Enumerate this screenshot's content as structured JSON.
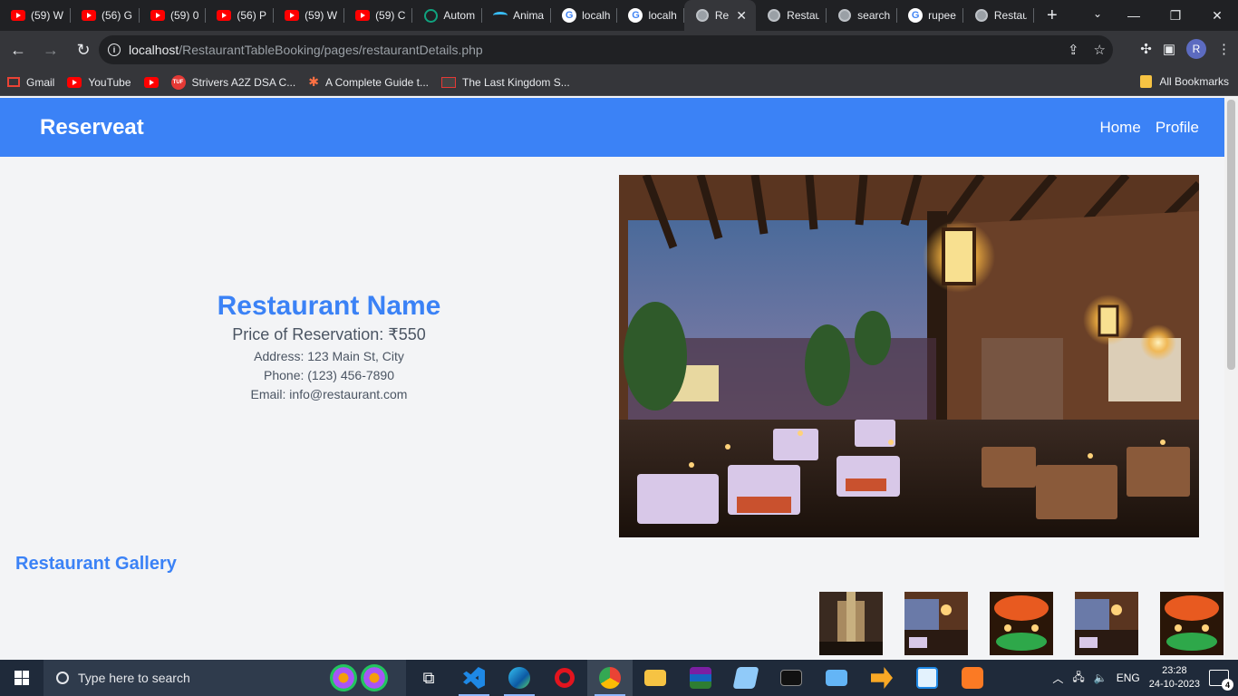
{
  "browser": {
    "tabs": [
      {
        "label": "(59) W",
        "icon": "youtube-icon"
      },
      {
        "label": "(56) G",
        "icon": "youtube-icon"
      },
      {
        "label": "(59) 0",
        "icon": "youtube-icon"
      },
      {
        "label": "(56) P",
        "icon": "youtube-icon"
      },
      {
        "label": "(59) W",
        "icon": "youtube-icon"
      },
      {
        "label": "(59) C",
        "icon": "youtube-icon"
      },
      {
        "label": "Autom",
        "icon": "chatgpt-icon"
      },
      {
        "label": "Anima",
        "icon": "tailwind-icon"
      },
      {
        "label": "localh",
        "icon": "google-icon"
      },
      {
        "label": "localh",
        "icon": "google-icon"
      },
      {
        "label": "Re",
        "icon": "globe-icon",
        "active": true
      },
      {
        "label": "Restau",
        "icon": "globe-icon"
      },
      {
        "label": "search",
        "icon": "globe-icon"
      },
      {
        "label": "rupee",
        "icon": "google-icon"
      },
      {
        "label": "Restau",
        "icon": "globe-icon"
      }
    ],
    "url_host": "localhost",
    "url_path": "/RestaurantTableBooking/pages/restaurantDetails.php",
    "profile_initial": "R",
    "bookmarks": [
      {
        "label": "Gmail",
        "icon": "gmail-icon"
      },
      {
        "label": "YouTube",
        "icon": "youtube-icon"
      },
      {
        "label": "",
        "icon": "youtube-icon"
      },
      {
        "label": "Strivers A2Z DSA C...",
        "icon": "tuf-icon"
      },
      {
        "label": "A Complete Guide t...",
        "icon": "asterisk-icon"
      },
      {
        "label": "The Last Kingdom S...",
        "icon": "tv-icon"
      }
    ],
    "all_bookmarks_label": "All Bookmarks"
  },
  "navbar": {
    "brand": "Reserveat",
    "links": [
      "Home",
      "Profile"
    ],
    "color": "#3b82f6"
  },
  "restaurant": {
    "name": "Restaurant Name",
    "price": "Price of Reservation: ₹550",
    "address": "Address: 123 Main St, City",
    "phone": "Phone: (123) 456-7890",
    "email": "Email: info@restaurant.com"
  },
  "gallery": {
    "title": "Restaurant Gallery",
    "thumbnails": 5
  },
  "taskbar": {
    "search_placeholder": "Type here to search",
    "language": "ENG",
    "time": "23:28",
    "date": "24-10-2023",
    "notifications": "4"
  }
}
